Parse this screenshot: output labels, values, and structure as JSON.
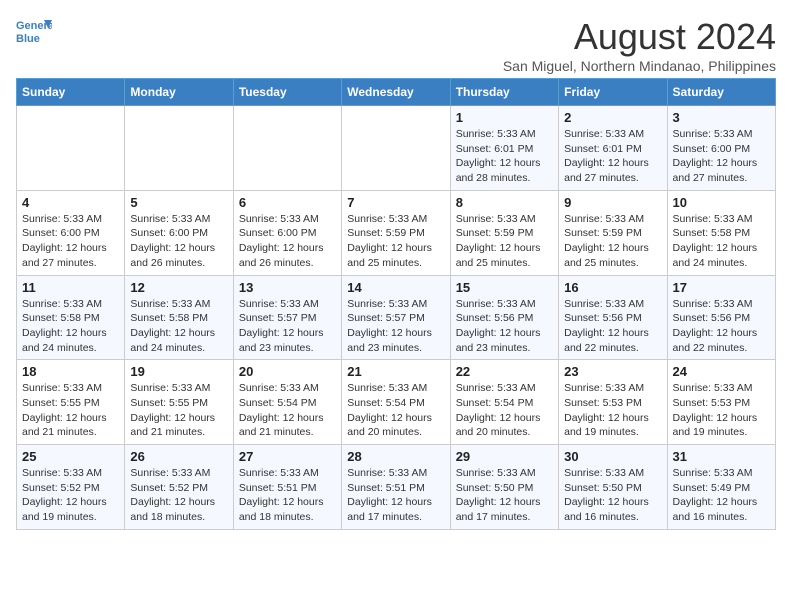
{
  "header": {
    "logo_line1": "General",
    "logo_line2": "Blue",
    "month_year": "August 2024",
    "location": "San Miguel, Northern Mindanao, Philippines"
  },
  "weekdays": [
    "Sunday",
    "Monday",
    "Tuesday",
    "Wednesday",
    "Thursday",
    "Friday",
    "Saturday"
  ],
  "weeks": [
    [
      {
        "day": "",
        "info": ""
      },
      {
        "day": "",
        "info": ""
      },
      {
        "day": "",
        "info": ""
      },
      {
        "day": "",
        "info": ""
      },
      {
        "day": "1",
        "info": "Sunrise: 5:33 AM\nSunset: 6:01 PM\nDaylight: 12 hours\nand 28 minutes."
      },
      {
        "day": "2",
        "info": "Sunrise: 5:33 AM\nSunset: 6:01 PM\nDaylight: 12 hours\nand 27 minutes."
      },
      {
        "day": "3",
        "info": "Sunrise: 5:33 AM\nSunset: 6:00 PM\nDaylight: 12 hours\nand 27 minutes."
      }
    ],
    [
      {
        "day": "4",
        "info": "Sunrise: 5:33 AM\nSunset: 6:00 PM\nDaylight: 12 hours\nand 27 minutes."
      },
      {
        "day": "5",
        "info": "Sunrise: 5:33 AM\nSunset: 6:00 PM\nDaylight: 12 hours\nand 26 minutes."
      },
      {
        "day": "6",
        "info": "Sunrise: 5:33 AM\nSunset: 6:00 PM\nDaylight: 12 hours\nand 26 minutes."
      },
      {
        "day": "7",
        "info": "Sunrise: 5:33 AM\nSunset: 5:59 PM\nDaylight: 12 hours\nand 25 minutes."
      },
      {
        "day": "8",
        "info": "Sunrise: 5:33 AM\nSunset: 5:59 PM\nDaylight: 12 hours\nand 25 minutes."
      },
      {
        "day": "9",
        "info": "Sunrise: 5:33 AM\nSunset: 5:59 PM\nDaylight: 12 hours\nand 25 minutes."
      },
      {
        "day": "10",
        "info": "Sunrise: 5:33 AM\nSunset: 5:58 PM\nDaylight: 12 hours\nand 24 minutes."
      }
    ],
    [
      {
        "day": "11",
        "info": "Sunrise: 5:33 AM\nSunset: 5:58 PM\nDaylight: 12 hours\nand 24 minutes."
      },
      {
        "day": "12",
        "info": "Sunrise: 5:33 AM\nSunset: 5:58 PM\nDaylight: 12 hours\nand 24 minutes."
      },
      {
        "day": "13",
        "info": "Sunrise: 5:33 AM\nSunset: 5:57 PM\nDaylight: 12 hours\nand 23 minutes."
      },
      {
        "day": "14",
        "info": "Sunrise: 5:33 AM\nSunset: 5:57 PM\nDaylight: 12 hours\nand 23 minutes."
      },
      {
        "day": "15",
        "info": "Sunrise: 5:33 AM\nSunset: 5:56 PM\nDaylight: 12 hours\nand 23 minutes."
      },
      {
        "day": "16",
        "info": "Sunrise: 5:33 AM\nSunset: 5:56 PM\nDaylight: 12 hours\nand 22 minutes."
      },
      {
        "day": "17",
        "info": "Sunrise: 5:33 AM\nSunset: 5:56 PM\nDaylight: 12 hours\nand 22 minutes."
      }
    ],
    [
      {
        "day": "18",
        "info": "Sunrise: 5:33 AM\nSunset: 5:55 PM\nDaylight: 12 hours\nand 21 minutes."
      },
      {
        "day": "19",
        "info": "Sunrise: 5:33 AM\nSunset: 5:55 PM\nDaylight: 12 hours\nand 21 minutes."
      },
      {
        "day": "20",
        "info": "Sunrise: 5:33 AM\nSunset: 5:54 PM\nDaylight: 12 hours\nand 21 minutes."
      },
      {
        "day": "21",
        "info": "Sunrise: 5:33 AM\nSunset: 5:54 PM\nDaylight: 12 hours\nand 20 minutes."
      },
      {
        "day": "22",
        "info": "Sunrise: 5:33 AM\nSunset: 5:54 PM\nDaylight: 12 hours\nand 20 minutes."
      },
      {
        "day": "23",
        "info": "Sunrise: 5:33 AM\nSunset: 5:53 PM\nDaylight: 12 hours\nand 19 minutes."
      },
      {
        "day": "24",
        "info": "Sunrise: 5:33 AM\nSunset: 5:53 PM\nDaylight: 12 hours\nand 19 minutes."
      }
    ],
    [
      {
        "day": "25",
        "info": "Sunrise: 5:33 AM\nSunset: 5:52 PM\nDaylight: 12 hours\nand 19 minutes."
      },
      {
        "day": "26",
        "info": "Sunrise: 5:33 AM\nSunset: 5:52 PM\nDaylight: 12 hours\nand 18 minutes."
      },
      {
        "day": "27",
        "info": "Sunrise: 5:33 AM\nSunset: 5:51 PM\nDaylight: 12 hours\nand 18 minutes."
      },
      {
        "day": "28",
        "info": "Sunrise: 5:33 AM\nSunset: 5:51 PM\nDaylight: 12 hours\nand 17 minutes."
      },
      {
        "day": "29",
        "info": "Sunrise: 5:33 AM\nSunset: 5:50 PM\nDaylight: 12 hours\nand 17 minutes."
      },
      {
        "day": "30",
        "info": "Sunrise: 5:33 AM\nSunset: 5:50 PM\nDaylight: 12 hours\nand 16 minutes."
      },
      {
        "day": "31",
        "info": "Sunrise: 5:33 AM\nSunset: 5:49 PM\nDaylight: 12 hours\nand 16 minutes."
      }
    ]
  ]
}
